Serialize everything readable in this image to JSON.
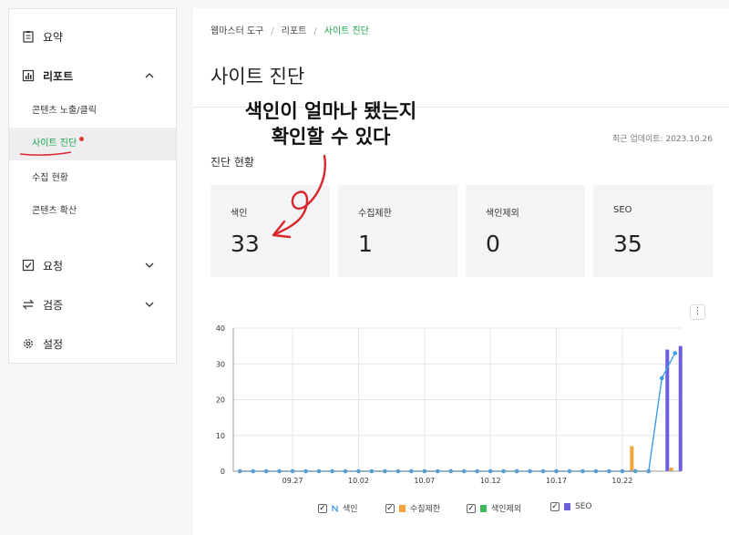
{
  "sidebar": {
    "summary": "요약",
    "report": "리포트",
    "report_items": [
      {
        "label": "콘텐츠 노출/클릭"
      },
      {
        "label": "사이트 진단"
      },
      {
        "label": "수집 현황"
      },
      {
        "label": "콘텐츠 확산"
      }
    ],
    "request": "요청",
    "verify": "검증",
    "settings": "설정"
  },
  "breadcrumb": [
    "웹마스터 도구",
    "리포트",
    "사이트 진단"
  ],
  "page_title": "사이트 진단",
  "updated": "최근 업데이트: 2023.10.26",
  "section_title": "진단 현황",
  "cards": [
    {
      "label": "색인",
      "value": "33"
    },
    {
      "label": "수집제한",
      "value": "1"
    },
    {
      "label": "색인제외",
      "value": "0"
    },
    {
      "label": "SEO",
      "value": "35"
    }
  ],
  "annotation": {
    "line1": "색인이 얼마나 됐는지",
    "line2": "확인할 수 있다"
  },
  "colors": {
    "index": "#3b9de8",
    "limit": "#f5a53a",
    "excluded": "#3dbb5b",
    "seo": "#6b5fe0",
    "accent": "#19a34a"
  },
  "chart_data": {
    "type": "bar",
    "x_ticks": [
      "09.27",
      "10.02",
      "10.07",
      "10.12",
      "10.17",
      "10.22"
    ],
    "y_ticks": [
      0,
      10,
      20,
      30,
      40
    ],
    "ylim": [
      0,
      40
    ],
    "days": [
      "09.23",
      "09.24",
      "09.25",
      "09.26",
      "09.27",
      "09.28",
      "09.29",
      "09.30",
      "10.01",
      "10.02",
      "10.03",
      "10.04",
      "10.05",
      "10.06",
      "10.07",
      "10.08",
      "10.09",
      "10.10",
      "10.11",
      "10.12",
      "10.13",
      "10.14",
      "10.15",
      "10.16",
      "10.17",
      "10.18",
      "10.19",
      "10.20",
      "10.21",
      "10.22",
      "10.23",
      "10.24",
      "10.25",
      "10.26"
    ],
    "series": [
      {
        "name": "색인",
        "kind": "line",
        "values": [
          0,
          0,
          0,
          0,
          0,
          0,
          0,
          0,
          0,
          0,
          0,
          0,
          0,
          0,
          0,
          0,
          0,
          0,
          0,
          0,
          0,
          0,
          0,
          0,
          0,
          0,
          0,
          0,
          0,
          0,
          0,
          0,
          26,
          33
        ]
      },
      {
        "name": "수집제한",
        "kind": "bar",
        "values": [
          0,
          0,
          0,
          0,
          0,
          0,
          0,
          0,
          0,
          0,
          0,
          0,
          0,
          0,
          0,
          0,
          0,
          0,
          0,
          0,
          0,
          0,
          0,
          0,
          0,
          0,
          0,
          0,
          0,
          0,
          7,
          0,
          0,
          1
        ]
      },
      {
        "name": "색인제외",
        "kind": "bar",
        "values": [
          0,
          0,
          0,
          0,
          0,
          0,
          0,
          0,
          0,
          0,
          0,
          0,
          0,
          0,
          0,
          0,
          0,
          0,
          0,
          0,
          0,
          0,
          0,
          0,
          0,
          0,
          0,
          0,
          0,
          0,
          0,
          0,
          0,
          0
        ]
      },
      {
        "name": "SEO",
        "kind": "bar",
        "values": [
          0,
          0,
          0,
          0,
          0,
          0,
          0,
          0,
          0,
          0,
          0,
          0,
          0,
          0,
          0,
          0,
          0,
          0,
          0,
          0,
          0,
          0,
          0,
          0,
          0,
          0,
          0,
          0,
          0,
          0,
          0,
          0,
          34,
          35
        ]
      }
    ]
  }
}
